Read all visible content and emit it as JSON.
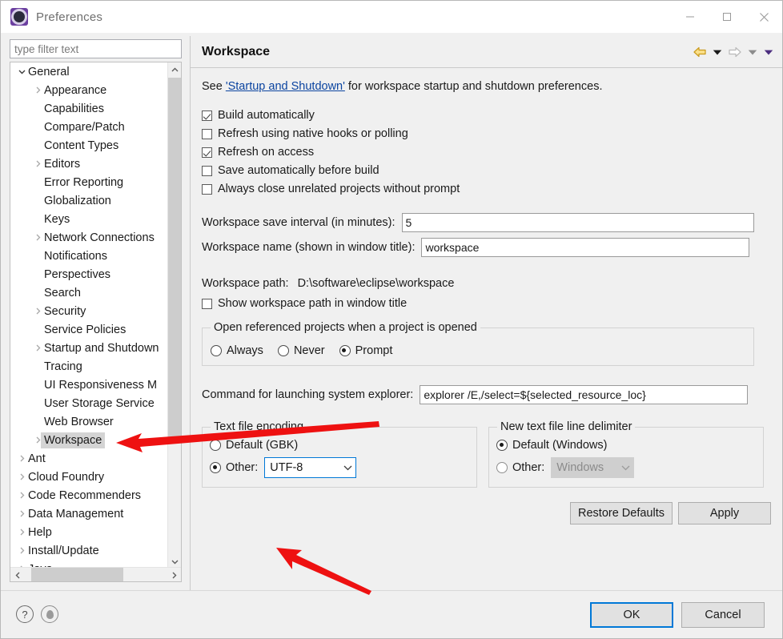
{
  "window": {
    "title": "Preferences",
    "icon": "preferences-gear-icon",
    "minimize_label": "—",
    "maximize_label": "□",
    "close_label": "✕"
  },
  "sidebar": {
    "filter": {
      "value": "",
      "placeholder": "type filter text"
    },
    "items": [
      {
        "label": "General",
        "level": 1,
        "twisty": "down",
        "selected": false
      },
      {
        "label": "Appearance",
        "level": 2,
        "twisty": "right",
        "selected": false
      },
      {
        "label": "Capabilities",
        "level": 2,
        "twisty": "none",
        "selected": false
      },
      {
        "label": "Compare/Patch",
        "level": 2,
        "twisty": "none",
        "selected": false
      },
      {
        "label": "Content Types",
        "level": 2,
        "twisty": "none",
        "selected": false
      },
      {
        "label": "Editors",
        "level": 2,
        "twisty": "right",
        "selected": false
      },
      {
        "label": "Error Reporting",
        "level": 2,
        "twisty": "none",
        "selected": false
      },
      {
        "label": "Globalization",
        "level": 2,
        "twisty": "none",
        "selected": false
      },
      {
        "label": "Keys",
        "level": 2,
        "twisty": "none",
        "selected": false
      },
      {
        "label": "Network Connections",
        "level": 2,
        "twisty": "right",
        "selected": false
      },
      {
        "label": "Notifications",
        "level": 2,
        "twisty": "none",
        "selected": false
      },
      {
        "label": "Perspectives",
        "level": 2,
        "twisty": "none",
        "selected": false
      },
      {
        "label": "Search",
        "level": 2,
        "twisty": "none",
        "selected": false
      },
      {
        "label": "Security",
        "level": 2,
        "twisty": "right",
        "selected": false
      },
      {
        "label": "Service Policies",
        "level": 2,
        "twisty": "none",
        "selected": false
      },
      {
        "label": "Startup and Shutdown",
        "level": 2,
        "twisty": "right",
        "selected": false
      },
      {
        "label": "Tracing",
        "level": 2,
        "twisty": "none",
        "selected": false
      },
      {
        "label": "UI Responsiveness M",
        "level": 2,
        "twisty": "none",
        "selected": false
      },
      {
        "label": "User Storage Service",
        "level": 2,
        "twisty": "none",
        "selected": false
      },
      {
        "label": "Web Browser",
        "level": 2,
        "twisty": "none",
        "selected": false
      },
      {
        "label": "Workspace",
        "level": 2,
        "twisty": "right",
        "selected": true
      },
      {
        "label": "Ant",
        "level": 1,
        "twisty": "right",
        "selected": false
      },
      {
        "label": "Cloud Foundry",
        "level": 1,
        "twisty": "right",
        "selected": false
      },
      {
        "label": "Code Recommenders",
        "level": 1,
        "twisty": "right",
        "selected": false
      },
      {
        "label": "Data Management",
        "level": 1,
        "twisty": "right",
        "selected": false
      },
      {
        "label": "Help",
        "level": 1,
        "twisty": "right",
        "selected": false
      },
      {
        "label": "Install/Update",
        "level": 1,
        "twisty": "right",
        "selected": false
      },
      {
        "label": "Java",
        "level": 1,
        "twisty": "right",
        "selected": false
      }
    ]
  },
  "page": {
    "title": "Workspace",
    "nav": {
      "back_icon": "back-arrow-icon",
      "back_menu_icon": "caret-down-icon",
      "forward_icon": "forward-arrow-icon",
      "forward_menu_icon": "caret-down-icon",
      "view_menu_icon": "caret-down-icon"
    },
    "description": {
      "before": "See ",
      "link": "'Startup and Shutdown'",
      "after": " for workspace startup and shutdown preferences."
    },
    "checkboxes": [
      {
        "label": "Build automatically",
        "checked": true
      },
      {
        "label": "Refresh using native hooks or polling",
        "checked": false
      },
      {
        "label": "Refresh on access",
        "checked": true
      },
      {
        "label": "Save automatically before build",
        "checked": false
      },
      {
        "label": "Always close unrelated projects without prompt",
        "checked": false
      }
    ],
    "save_interval": {
      "label": "Workspace save interval (in minutes):",
      "value": "5"
    },
    "workspace_name": {
      "label": "Workspace name (shown in window title):",
      "value": "workspace"
    },
    "workspace_path": {
      "label": "Workspace path:",
      "value": "D:\\software\\eclipse\\workspace"
    },
    "show_path_checkbox": {
      "label": "Show workspace path in window title",
      "checked": false
    },
    "referenced_projects": {
      "title": "Open referenced projects when a project is opened",
      "options": [
        {
          "label": "Always",
          "selected": false
        },
        {
          "label": "Never",
          "selected": false
        },
        {
          "label": "Prompt",
          "selected": true
        }
      ]
    },
    "explorer_command": {
      "label": "Command for launching system explorer:",
      "value": "explorer /E,/select=${selected_resource_loc}"
    },
    "text_file_encoding": {
      "title": "Text file encoding",
      "default_label": "Default (GBK)",
      "default_selected": false,
      "other_label": "Other:",
      "other_selected": true,
      "other_value": "UTF-8"
    },
    "line_delimiter": {
      "title": "New text file line delimiter",
      "default_label": "Default (Windows)",
      "default_selected": true,
      "other_label": "Other:",
      "other_selected": false,
      "other_value": "Windows"
    },
    "restore_defaults_label": "Restore Defaults",
    "apply_label": "Apply"
  },
  "footer": {
    "help_icon": "help-question-icon",
    "pin_icon": "pin-icon",
    "ok_label": "OK",
    "cancel_label": "Cancel"
  },
  "annotations": {
    "arrow_color": "#ee1111",
    "arrow1_target": "Workspace tree item",
    "arrow2_target": "Text file encoding Other combo"
  },
  "colors": {
    "accent": "#0078d7",
    "link": "#0b44a0",
    "selection": "#d4d4d4",
    "dialog_bg": "#f0f0f0"
  }
}
